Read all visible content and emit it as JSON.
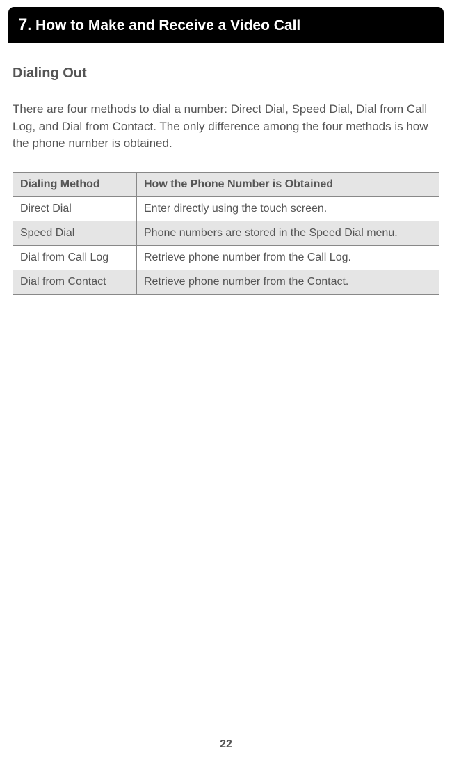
{
  "header": {
    "chapter_number": "7",
    "chapter_title": ". How to Make and Receive a Video Call"
  },
  "subsection": {
    "title": "Dialing Out",
    "intro": "There are four methods to dial a number: Direct Dial, Speed Dial, Dial from Call Log, and Dial from Contact. The only difference among the four methods is how the phone number is obtained."
  },
  "table": {
    "headers": {
      "method": "Dialing Method",
      "obtained": "How the Phone Number is Obtained"
    },
    "rows": [
      {
        "method": "Direct Dial",
        "obtained": "Enter directly using the touch screen."
      },
      {
        "method": "Speed Dial",
        "obtained": "Phone numbers are stored in the Speed Dial menu."
      },
      {
        "method": "Dial from Call Log",
        "obtained": "Retrieve phone number from the Call Log."
      },
      {
        "method": "Dial from Contact",
        "obtained": "Retrieve phone number from the Contact."
      }
    ]
  },
  "page_number": "22"
}
